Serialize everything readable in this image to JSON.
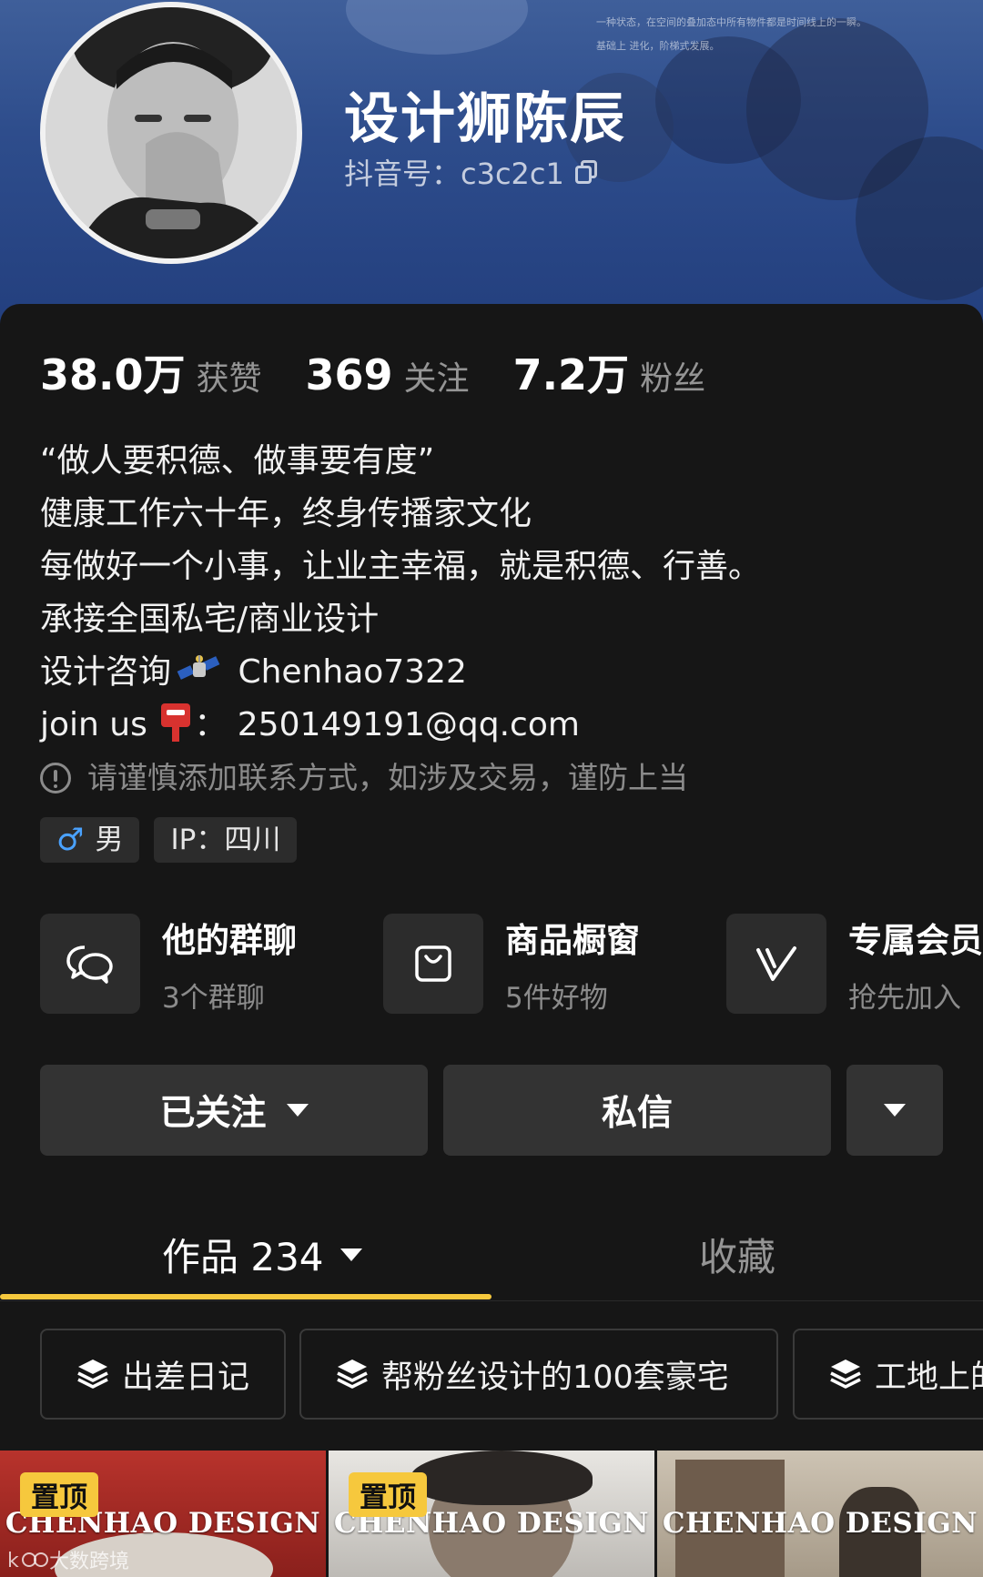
{
  "profile": {
    "name": "设计狮陈辰",
    "douyin_id": "抖音号：c3c2c1"
  },
  "stats": [
    {
      "num": "38.0万",
      "label": "获赞"
    },
    {
      "num": "369",
      "label": "关注"
    },
    {
      "num": "7.2万",
      "label": "粉丝"
    }
  ],
  "bio": {
    "line1": "“做人要积德、做事要有度”",
    "line2": "健康工作六十年，终身传播家文化",
    "line3": "每做好一个小事，让业主幸福，就是积德、行善。",
    "line4": "承接全国私宅/商业设计",
    "line5_prefix": "设计咨询",
    "line5_suffix": " Chenhao7322",
    "line6_prefix": "join us",
    "line6_suffix": "：  250149191@qq.com",
    "warning": "请谨慎添加联系方式，如涉及交易，谨防上当"
  },
  "tags": {
    "gender": "男",
    "ip": "IP：四川"
  },
  "shortcuts": [
    {
      "title": "他的群聊",
      "sub": "3个群聊",
      "icon": "chat-bubbles-icon"
    },
    {
      "title": "商品橱窗",
      "sub": "5件好物",
      "icon": "shopping-bag-icon"
    },
    {
      "title": "专属会员",
      "sub": "抢先加入",
      "icon": "v-badge-icon"
    }
  ],
  "actions": {
    "follow": "已关注",
    "message": "私信"
  },
  "tabs": {
    "works": "作品 234",
    "favorites": "收藏"
  },
  "collections": [
    "出差日记",
    "帮粉丝设计的100套豪宅",
    "工地上的"
  ],
  "thumbnails": [
    {
      "brand": "CHENHAO DESIGN",
      "pin": "置顶"
    },
    {
      "brand": "CHENHAO DESIGN",
      "pin": "置顶"
    },
    {
      "brand": "CHENHAO DESIGN",
      "pin": ""
    }
  ],
  "watermark": "大数跨境",
  "colors": {
    "accent_yellow": "#f6c83d",
    "male_blue": "#4aa2ff",
    "header_blue": "#2e4d8c"
  }
}
